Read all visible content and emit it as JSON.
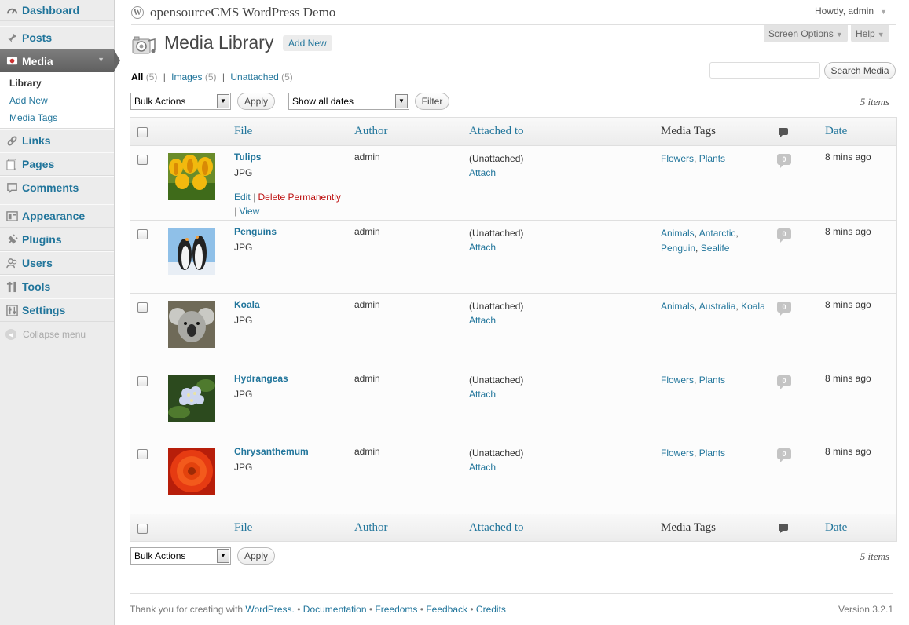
{
  "sidebar": {
    "items": [
      {
        "label": "Dashboard",
        "icon": "dashboard-icon"
      },
      {
        "label": "Posts",
        "icon": "pin-icon"
      },
      {
        "label": "Media",
        "icon": "media-icon"
      },
      {
        "label": "Links",
        "icon": "link-icon"
      },
      {
        "label": "Pages",
        "icon": "pages-icon"
      },
      {
        "label": "Comments",
        "icon": "comments-icon"
      },
      {
        "label": "Appearance",
        "icon": "appearance-icon"
      },
      {
        "label": "Plugins",
        "icon": "plugins-icon"
      },
      {
        "label": "Users",
        "icon": "users-icon"
      },
      {
        "label": "Tools",
        "icon": "tools-icon"
      },
      {
        "label": "Settings",
        "icon": "settings-icon"
      }
    ],
    "media_submenu": [
      "Library",
      "Add New",
      "Media Tags"
    ],
    "collapse_label": "Collapse menu"
  },
  "header": {
    "site_title": "opensourceCMS WordPress Demo",
    "howdy": "Howdy, admin",
    "screen_options": "Screen Options",
    "help": "Help"
  },
  "page": {
    "title": "Media Library",
    "add_new": "Add New"
  },
  "filters": {
    "all": "All",
    "all_count": "(5)",
    "images": "Images",
    "images_count": "(5)",
    "unattached": "Unattached",
    "unattached_count": "(5)",
    "sep": "|"
  },
  "search": {
    "button": "Search Media",
    "value": ""
  },
  "toolbar": {
    "bulk_actions": "Bulk Actions",
    "apply": "Apply",
    "dates": "Show all dates",
    "filter": "Filter",
    "items_count": "5 items"
  },
  "table": {
    "columns": {
      "file": "File",
      "author": "Author",
      "attached": "Attached to",
      "tags": "Media Tags",
      "date": "Date"
    },
    "row_actions": {
      "edit": "Edit",
      "delete": "Delete Permanently",
      "view": "View",
      "sep": "|"
    },
    "rows": [
      {
        "title": "Tulips",
        "type": "JPG",
        "author": "admin",
        "attached": "(Unattached)",
        "attach": "Attach",
        "tags": [
          "Flowers",
          "Plants"
        ],
        "comments": "0",
        "date": "8 mins ago",
        "thumb": "tulips"
      },
      {
        "title": "Penguins",
        "type": "JPG",
        "author": "admin",
        "attached": "(Unattached)",
        "attach": "Attach",
        "tags": [
          "Animals",
          "Antarctic",
          "Penguin",
          "Sealife"
        ],
        "comments": "0",
        "date": "8 mins ago",
        "thumb": "penguins"
      },
      {
        "title": "Koala",
        "type": "JPG",
        "author": "admin",
        "attached": "(Unattached)",
        "attach": "Attach",
        "tags": [
          "Animals",
          "Australia",
          "Koala"
        ],
        "comments": "0",
        "date": "8 mins ago",
        "thumb": "koala"
      },
      {
        "title": "Hydrangeas",
        "type": "JPG",
        "author": "admin",
        "attached": "(Unattached)",
        "attach": "Attach",
        "tags": [
          "Flowers",
          "Plants"
        ],
        "comments": "0",
        "date": "8 mins ago",
        "thumb": "hydrangeas"
      },
      {
        "title": "Chrysanthemum",
        "type": "JPG",
        "author": "admin",
        "attached": "(Unattached)",
        "attach": "Attach",
        "tags": [
          "Flowers",
          "Plants"
        ],
        "comments": "0",
        "date": "8 mins ago",
        "thumb": "chrysanthemum"
      }
    ]
  },
  "footer": {
    "thanks": "Thank you for creating with",
    "wordpress": "WordPress.",
    "documentation": "Documentation",
    "freedoms": "Freedoms",
    "feedback": "Feedback",
    "credits": "Credits",
    "bullet": "•",
    "version": "Version 3.2.1"
  },
  "colors": {
    "link": "#21759b",
    "delete": "#bc0b0b",
    "current_menu": "#6d6d6d"
  }
}
